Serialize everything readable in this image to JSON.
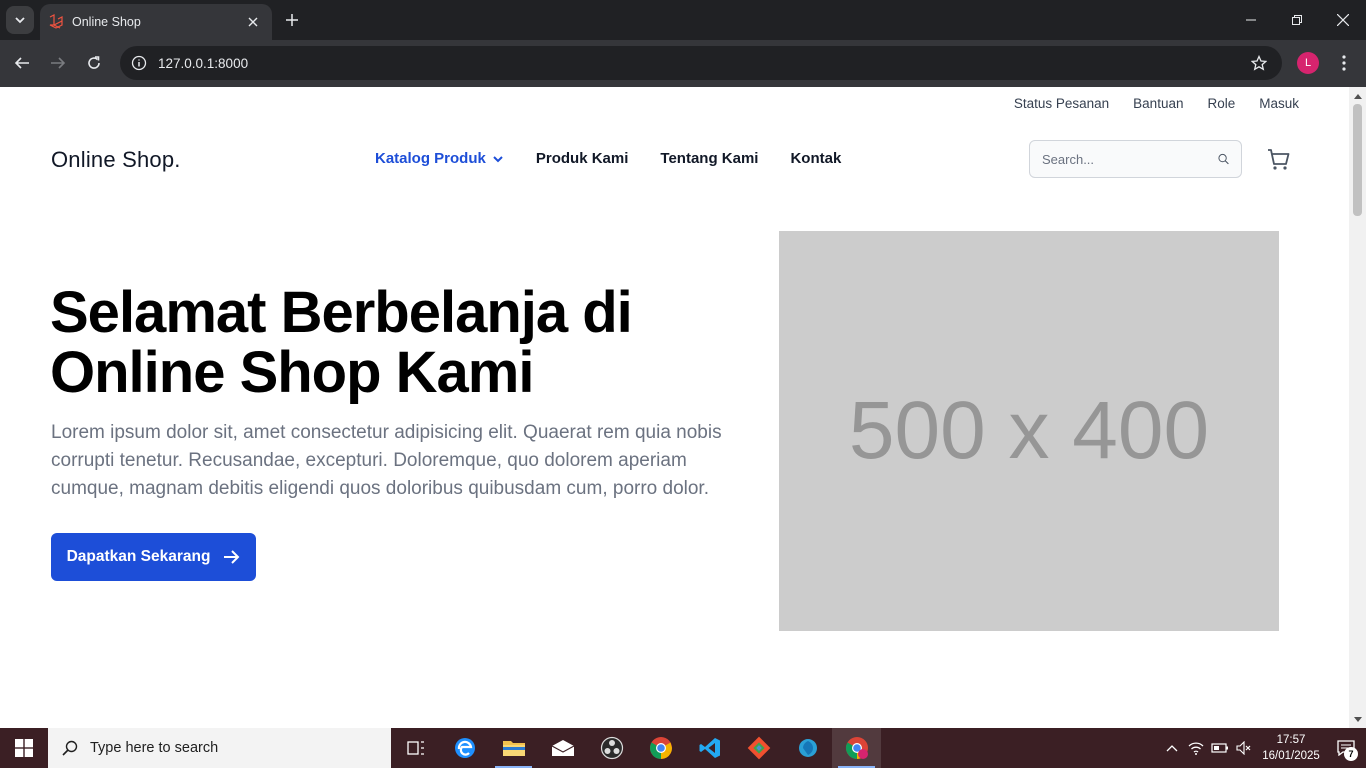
{
  "browser": {
    "tab_title": "Online Shop",
    "url": "127.0.0.1:8000",
    "profile_initial": "L"
  },
  "page": {
    "top_links": [
      "Status Pesanan",
      "Bantuan",
      "Role",
      "Masuk"
    ],
    "brand": "Online Shop.",
    "nav": [
      {
        "label": "Katalog Produk",
        "active": true
      },
      {
        "label": "Produk Kami"
      },
      {
        "label": "Tentang Kami"
      },
      {
        "label": "Kontak"
      }
    ],
    "search_placeholder": "Search...",
    "hero": {
      "title": "Selamat Berbelanja di Online Shop Kami",
      "description": "Lorem ipsum dolor sit, amet consectetur adipisicing elit. Quaerat rem quia nobis corrupti tenetur. Recusandae, excepturi. Doloremque, quo dolorem aperiam cumque, magnam debitis eligendi quos doloribus quibusdam cum, porro dolor.",
      "cta_label": "Dapatkan Sekarang",
      "image_placeholder": "500 x 400"
    }
  },
  "taskbar": {
    "search_placeholder": "Type here to search",
    "time": "17:57",
    "date": "16/01/2025",
    "notification_count": "7",
    "apps": [
      "task-view-icon",
      "edge-icon",
      "file-explorer-icon",
      "mail-icon",
      "obs-icon",
      "chrome-icon",
      "vscode-icon",
      "git-icon",
      "app-icon",
      "chrome-profile-icon"
    ]
  },
  "colors": {
    "accent": "#1d4ed8",
    "browser_dark": "#202124",
    "taskbar": "#3b1f24",
    "placeholder_bg": "#cccccc"
  }
}
